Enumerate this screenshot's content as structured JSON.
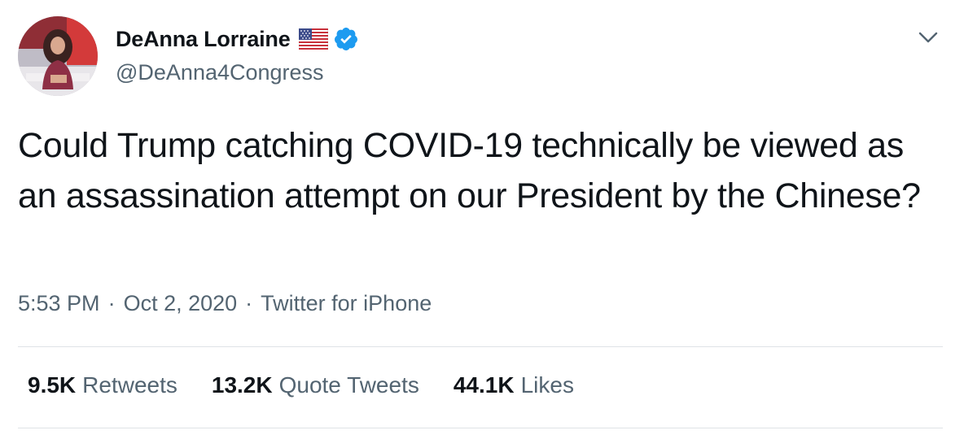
{
  "author": {
    "display_name": "DeAnna Lorraine",
    "handle": "@DeAnna4Congress",
    "flag_icon": "us-flag-icon",
    "verified": true
  },
  "tweet": {
    "text": "Could Trump catching COVID-19 technically be viewed as an assassination attempt on our President by the Chinese?",
    "time": "5:53 PM",
    "separator": "·",
    "date": "Oct 2, 2020",
    "source": "Twitter for iPhone"
  },
  "stats": {
    "retweets_count": "9.5K",
    "retweets_label": "Retweets",
    "quote_count": "13.2K",
    "quote_label": "Quote Tweets",
    "likes_count": "44.1K",
    "likes_label": "Likes"
  },
  "colors": {
    "verified_blue": "#1d9bf0",
    "secondary_text": "#536471",
    "primary_text": "#0f1419"
  }
}
